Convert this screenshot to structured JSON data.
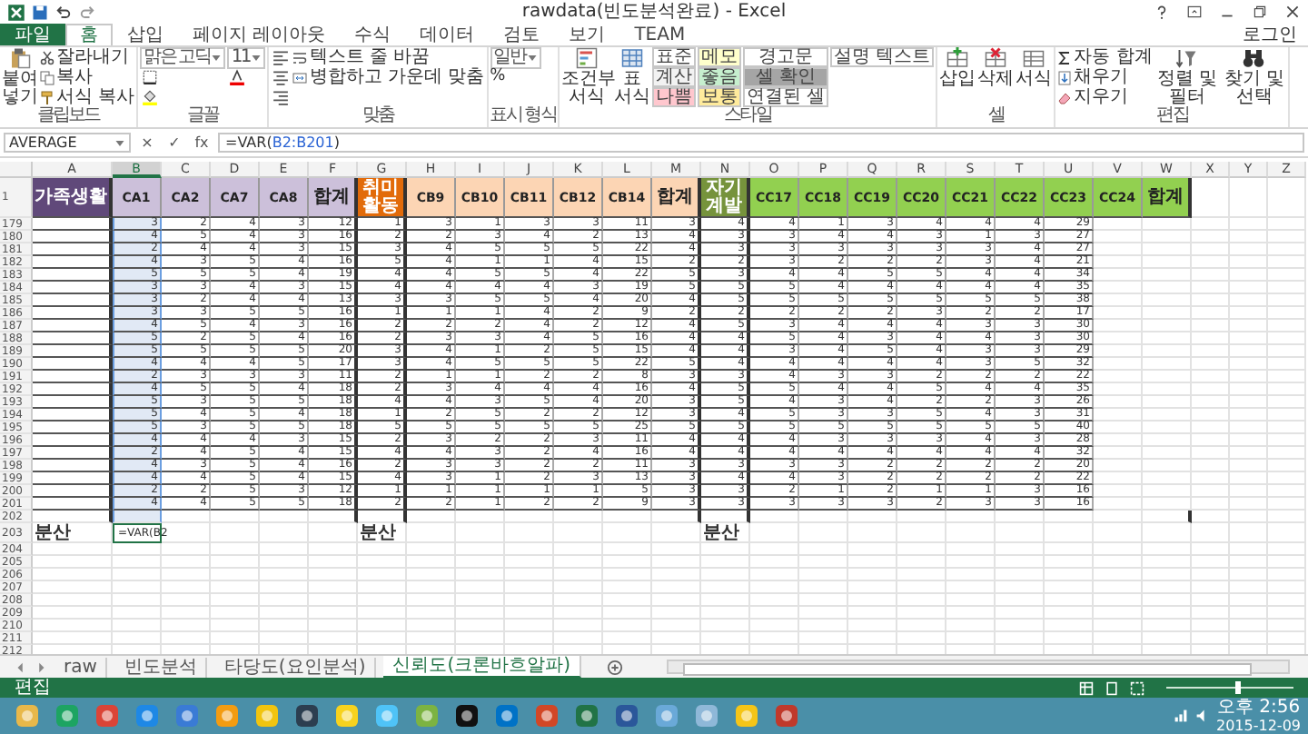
{
  "window": {
    "title": "rawdata(빈도분석완료) - Excel",
    "account": "로그인"
  },
  "ribbon_tabs": [
    {
      "label": "파일",
      "kind": "file",
      "selected": false
    },
    {
      "label": "홈",
      "kind": "tab",
      "selected": true
    },
    {
      "label": "삽입",
      "kind": "tab",
      "selected": false
    },
    {
      "label": "페이지 레이아웃",
      "kind": "tab",
      "selected": false
    },
    {
      "label": "수식",
      "kind": "tab",
      "selected": false
    },
    {
      "label": "데이터",
      "kind": "tab",
      "selected": false
    },
    {
      "label": "검토",
      "kind": "tab",
      "selected": false
    },
    {
      "label": "보기",
      "kind": "tab",
      "selected": false
    },
    {
      "label": "TEAM",
      "kind": "tab",
      "selected": false
    }
  ],
  "ribbon_groups": [
    {
      "label": "클립보드",
      "items": [
        {
          "kind": "large",
          "label": "붙여넣기"
        },
        {
          "kind": "small",
          "label": "잘라내기"
        },
        {
          "kind": "small",
          "label": "복사"
        },
        {
          "kind": "small",
          "label": "서식 복사"
        }
      ]
    },
    {
      "label": "글꼴",
      "items": [
        {
          "kind": "field",
          "label": "맑은 고딕"
        },
        {
          "kind": "iconbtn"
        },
        {
          "kind": "iconbtn"
        },
        {
          "kind": "field",
          "label": "11"
        },
        {
          "kind": "iconbtn"
        }
      ]
    },
    {
      "label": "맞춤",
      "items": [
        {
          "kind": "iconbtn"
        },
        {
          "kind": "iconbtn"
        },
        {
          "kind": "iconbtn"
        },
        {
          "kind": "small",
          "label": "텍스트 줄 바꿈"
        },
        {
          "kind": "small",
          "label": "병합하고 가운데 맞춤"
        }
      ]
    },
    {
      "label": "표시 형식",
      "items": [
        {
          "kind": "field",
          "label": "일반"
        },
        {
          "kind": "glyph",
          "label": "%"
        }
      ]
    },
    {
      "label": "스타일",
      "items": [
        {
          "kind": "large",
          "label": "조건부 서식"
        },
        {
          "kind": "large",
          "label": "표 서식"
        },
        {
          "kind": "style",
          "label": "표준",
          "color": "#ffffff"
        },
        {
          "kind": "style",
          "label": "계산",
          "color": "#f2f2f2"
        },
        {
          "kind": "style",
          "label": "나쁨",
          "color": "#ffc7ce"
        },
        {
          "kind": "style",
          "label": "메모",
          "color": "#ffffcc"
        },
        {
          "kind": "style",
          "label": "좋음",
          "color": "#c6efce"
        },
        {
          "kind": "style",
          "label": "보통",
          "color": "#ffeb9c"
        },
        {
          "kind": "style",
          "label": "경고문",
          "color": "#ffffff"
        },
        {
          "kind": "style",
          "label": "셀 확인",
          "color": "#a5a5a5"
        },
        {
          "kind": "style",
          "label": "연결된 셀",
          "color": "#ffffff"
        },
        {
          "kind": "style",
          "label": "설명 텍스트",
          "color": "#ffffff"
        }
      ]
    },
    {
      "label": "셀",
      "items": [
        {
          "kind": "large",
          "label": "삽입"
        },
        {
          "kind": "large",
          "label": "삭제"
        },
        {
          "kind": "large",
          "label": "서식"
        }
      ]
    },
    {
      "label": "편집",
      "items": [
        {
          "kind": "small",
          "label": "자동 합계"
        },
        {
          "kind": "small",
          "label": "채우기"
        },
        {
          "kind": "small",
          "label": "지우기"
        },
        {
          "kind": "large",
          "label": "정렬 및 필터"
        },
        {
          "kind": "large",
          "label": "찾기 및 선택"
        }
      ]
    }
  ],
  "name_box": "AVERAGE",
  "formula_buttons": [
    "×",
    "✓",
    "fx"
  ],
  "formula": {
    "start": "=VAR(",
    "ref": "B2:B201",
    "end": ")"
  },
  "columns": [
    {
      "label": "A",
      "selected": false
    },
    {
      "label": "B",
      "selected": true
    },
    {
      "label": "C",
      "selected": false
    },
    {
      "label": "D",
      "selected": false
    },
    {
      "label": "E",
      "selected": false
    },
    {
      "label": "F",
      "selected": false
    },
    {
      "label": "G",
      "selected": false
    },
    {
      "label": "H",
      "selected": false
    },
    {
      "label": "I",
      "selected": false
    },
    {
      "label": "J",
      "selected": false
    },
    {
      "label": "K",
      "selected": false
    },
    {
      "label": "L",
      "selected": false
    },
    {
      "label": "M",
      "selected": false
    },
    {
      "label": "N",
      "selected": false
    },
    {
      "label": "O",
      "selected": false
    },
    {
      "label": "P",
      "selected": false
    },
    {
      "label": "Q",
      "selected": false
    },
    {
      "label": "R",
      "selected": false
    },
    {
      "label": "S",
      "selected": false
    },
    {
      "label": "T",
      "selected": false
    },
    {
      "label": "U",
      "selected": false
    },
    {
      "label": "V",
      "selected": false
    },
    {
      "label": "W",
      "selected": false
    },
    {
      "label": "X",
      "selected": false
    },
    {
      "label": "Y",
      "selected": false
    },
    {
      "label": "Z",
      "selected": false
    }
  ],
  "header_row": {
    "number": "1",
    "cells": [
      {
        "text": "가족생활",
        "color": "#60497a"
      },
      {
        "text": "CA1",
        "color": "#ccc0da"
      },
      {
        "text": "CA2",
        "color": "#ccc0da"
      },
      {
        "text": "CA7",
        "color": "#ccc0da"
      },
      {
        "text": "CA8",
        "color": "#ccc0da"
      },
      {
        "text": "합계",
        "color": "#ccc0da"
      },
      {
        "text": "취미활동",
        "color": "#e26b0a"
      },
      {
        "text": "CB9",
        "color": "#fcd5b4"
      },
      {
        "text": "CB10",
        "color": "#fcd5b4"
      },
      {
        "text": "CB11",
        "color": "#fcd5b4"
      },
      {
        "text": "CB12",
        "color": "#fcd5b4"
      },
      {
        "text": "CB14",
        "color": "#fcd5b4"
      },
      {
        "text": "합계",
        "color": "#fcd5b4"
      },
      {
        "text": "자기계발",
        "color": "#76933c"
      },
      {
        "text": "CC17",
        "color": "#92d050"
      },
      {
        "text": "CC18",
        "color": "#92d050"
      },
      {
        "text": "CC19",
        "color": "#92d050"
      },
      {
        "text": "CC20",
        "color": "#92d050"
      },
      {
        "text": "CC21",
        "color": "#92d050"
      },
      {
        "text": "CC22",
        "color": "#92d050"
      },
      {
        "text": "CC23",
        "color": "#92d050"
      },
      {
        "text": "CC24",
        "color": "#92d050"
      },
      {
        "text": "합계",
        "color": "#92d050"
      }
    ]
  },
  "rows": [
    {
      "number": "179",
      "cells": [
        "3",
        "2",
        "4",
        "3",
        "12",
        "1",
        "3",
        "1",
        "3",
        "3",
        "11",
        "3",
        "4",
        "4",
        "1",
        "3",
        "4",
        "4",
        "4",
        "29"
      ]
    },
    {
      "number": "180",
      "cells": [
        "4",
        "5",
        "4",
        "3",
        "16",
        "2",
        "2",
        "3",
        "4",
        "2",
        "13",
        "4",
        "3",
        "3",
        "4",
        "4",
        "3",
        "1",
        "3",
        "27"
      ]
    },
    {
      "number": "181",
      "cells": [
        "2",
        "4",
        "4",
        "3",
        "15",
        "3",
        "4",
        "5",
        "5",
        "5",
        "22",
        "4",
        "3",
        "3",
        "3",
        "3",
        "3",
        "3",
        "4",
        "27"
      ]
    },
    {
      "number": "182",
      "cells": [
        "4",
        "3",
        "5",
        "4",
        "16",
        "5",
        "4",
        "1",
        "1",
        "4",
        "15",
        "2",
        "2",
        "3",
        "2",
        "2",
        "2",
        "3",
        "4",
        "21"
      ]
    },
    {
      "number": "183",
      "cells": [
        "5",
        "5",
        "5",
        "4",
        "19",
        "4",
        "4",
        "5",
        "5",
        "4",
        "22",
        "5",
        "3",
        "4",
        "4",
        "5",
        "5",
        "4",
        "4",
        "34"
      ]
    },
    {
      "number": "184",
      "cells": [
        "3",
        "3",
        "4",
        "3",
        "15",
        "4",
        "4",
        "4",
        "4",
        "3",
        "19",
        "5",
        "5",
        "5",
        "4",
        "4",
        "4",
        "4",
        "4",
        "35"
      ]
    },
    {
      "number": "185",
      "cells": [
        "3",
        "2",
        "4",
        "4",
        "13",
        "3",
        "3",
        "5",
        "5",
        "4",
        "20",
        "4",
        "5",
        "5",
        "5",
        "5",
        "5",
        "5",
        "5",
        "38"
      ]
    },
    {
      "number": "186",
      "cells": [
        "3",
        "3",
        "5",
        "5",
        "16",
        "1",
        "1",
        "1",
        "4",
        "2",
        "9",
        "2",
        "2",
        "2",
        "2",
        "2",
        "3",
        "2",
        "2",
        "17"
      ]
    },
    {
      "number": "187",
      "cells": [
        "4",
        "5",
        "4",
        "3",
        "16",
        "2",
        "2",
        "2",
        "4",
        "2",
        "12",
        "4",
        "5",
        "3",
        "4",
        "4",
        "4",
        "3",
        "3",
        "30"
      ]
    },
    {
      "number": "188",
      "cells": [
        "5",
        "2",
        "5",
        "4",
        "16",
        "2",
        "3",
        "3",
        "4",
        "5",
        "16",
        "4",
        "4",
        "5",
        "4",
        "3",
        "4",
        "4",
        "3",
        "30"
      ]
    },
    {
      "number": "189",
      "cells": [
        "5",
        "5",
        "5",
        "5",
        "20",
        "3",
        "4",
        "1",
        "2",
        "5",
        "15",
        "4",
        "4",
        "3",
        "4",
        "5",
        "4",
        "3",
        "3",
        "29"
      ]
    },
    {
      "number": "190",
      "cells": [
        "4",
        "4",
        "4",
        "5",
        "17",
        "3",
        "4",
        "5",
        "5",
        "5",
        "22",
        "5",
        "4",
        "4",
        "4",
        "4",
        "4",
        "3",
        "5",
        "32"
      ]
    },
    {
      "number": "191",
      "cells": [
        "2",
        "3",
        "3",
        "3",
        "11",
        "2",
        "1",
        "1",
        "2",
        "2",
        "8",
        "3",
        "3",
        "4",
        "3",
        "3",
        "2",
        "2",
        "2",
        "22"
      ]
    },
    {
      "number": "192",
      "cells": [
        "4",
        "5",
        "5",
        "4",
        "18",
        "2",
        "3",
        "4",
        "4",
        "4",
        "16",
        "4",
        "5",
        "5",
        "4",
        "4",
        "5",
        "4",
        "4",
        "35"
      ]
    },
    {
      "number": "193",
      "cells": [
        "5",
        "3",
        "5",
        "5",
        "18",
        "4",
        "4",
        "3",
        "5",
        "4",
        "20",
        "3",
        "5",
        "4",
        "3",
        "4",
        "2",
        "2",
        "3",
        "26"
      ]
    },
    {
      "number": "194",
      "cells": [
        "5",
        "4",
        "5",
        "4",
        "18",
        "1",
        "2",
        "5",
        "2",
        "2",
        "12",
        "3",
        "4",
        "5",
        "3",
        "3",
        "5",
        "4",
        "3",
        "31"
      ]
    },
    {
      "number": "195",
      "cells": [
        "5",
        "3",
        "5",
        "5",
        "18",
        "5",
        "5",
        "5",
        "5",
        "5",
        "25",
        "5",
        "5",
        "5",
        "5",
        "5",
        "5",
        "5",
        "5",
        "40"
      ]
    },
    {
      "number": "196",
      "cells": [
        "4",
        "4",
        "4",
        "3",
        "15",
        "2",
        "3",
        "2",
        "2",
        "3",
        "11",
        "4",
        "4",
        "4",
        "3",
        "3",
        "3",
        "4",
        "3",
        "28"
      ]
    },
    {
      "number": "197",
      "cells": [
        "2",
        "4",
        "5",
        "4",
        "15",
        "4",
        "4",
        "3",
        "2",
        "4",
        "16",
        "4",
        "4",
        "4",
        "4",
        "4",
        "4",
        "4",
        "4",
        "32"
      ]
    },
    {
      "number": "198",
      "cells": [
        "4",
        "3",
        "5",
        "4",
        "16",
        "2",
        "3",
        "3",
        "2",
        "2",
        "11",
        "3",
        "3",
        "3",
        "3",
        "2",
        "2",
        "2",
        "2",
        "20"
      ]
    },
    {
      "number": "199",
      "cells": [
        "4",
        "4",
        "5",
        "4",
        "15",
        "4",
        "3",
        "1",
        "2",
        "3",
        "13",
        "3",
        "4",
        "4",
        "3",
        "2",
        "2",
        "2",
        "2",
        "22"
      ]
    },
    {
      "number": "200",
      "cells": [
        "2",
        "2",
        "5",
        "3",
        "12",
        "1",
        "1",
        "1",
        "1",
        "1",
        "5",
        "3",
        "3",
        "2",
        "1",
        "2",
        "1",
        "1",
        "3",
        "16"
      ]
    },
    {
      "number": "201",
      "cells": [
        "4",
        "4",
        "5",
        "5",
        "18",
        "2",
        "2",
        "1",
        "2",
        "2",
        "9",
        "3",
        "3",
        "3",
        "3",
        "3",
        "2",
        "3",
        "3",
        "16"
      ]
    }
  ],
  "blank_rows_before": [
    "202"
  ],
  "variance_row": {
    "number": "203",
    "cells": [
      {
        "kind": "label",
        "text": "분산"
      },
      {
        "kind": "editing",
        "text": "=VAR(B2"
      },
      {
        "kind": "empty"
      },
      {
        "kind": "empty"
      },
      {
        "kind": "empty"
      },
      {
        "kind": "empty"
      },
      {
        "kind": "label",
        "text": "분산"
      },
      {
        "kind": "empty"
      },
      {
        "kind": "empty"
      },
      {
        "kind": "empty"
      },
      {
        "kind": "empty"
      },
      {
        "kind": "empty"
      },
      {
        "kind": "empty"
      },
      {
        "kind": "label",
        "text": "분산"
      }
    ]
  },
  "blank_rows_after": [
    "204",
    "205",
    "206",
    "207",
    "208",
    "209",
    "210",
    "211",
    "212"
  ],
  "sheet_tabs": [
    {
      "label": "raw",
      "selected": false
    },
    {
      "label": "빈도분석",
      "selected": false
    },
    {
      "label": "타당도(요인분석)",
      "selected": false
    },
    {
      "label": "신뢰도(크론바흐알파)",
      "selected": true
    }
  ],
  "status_bar": {
    "mode": "편집",
    "zoom": {
      "level": 0.55
    }
  },
  "taskbar": {
    "time": "오후 2:56",
    "date": "2015-12-09"
  }
}
